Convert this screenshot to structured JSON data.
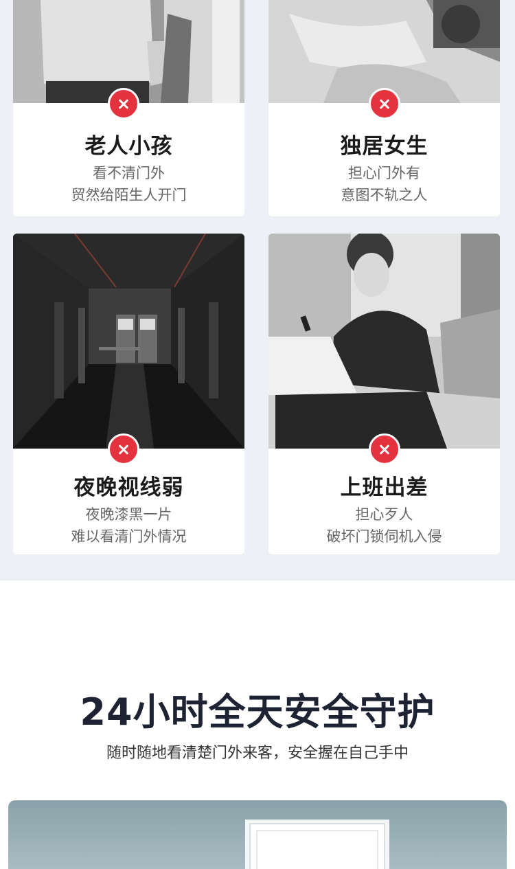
{
  "cards": [
    {
      "title": "老人小孩",
      "line1": "看不清门外",
      "line2": "贸然给陌生人开门",
      "photo_icon": "child-photo",
      "status_icon": "x-mark-icon"
    },
    {
      "title": "独居女生",
      "line1": "担心门外有",
      "line2": "意图不轨之人",
      "photo_icon": "woman-in-bed-photo",
      "status_icon": "x-mark-icon"
    },
    {
      "title": "夜晚视线弱",
      "line1": "夜晚漆黑一片",
      "line2": "难以看清门外情况",
      "photo_icon": "dark-corridor-photo",
      "status_icon": "x-mark-icon"
    },
    {
      "title": "上班出差",
      "line1": "担心歹人",
      "line2": "破坏门锁伺机入侵",
      "photo_icon": "businessman-laptop-photo",
      "status_icon": "x-mark-icon"
    }
  ],
  "section": {
    "headline": "24小时全天安全守护",
    "subline": "随时随地看清楚门外来客，安全握在自己手中"
  },
  "colors": {
    "accent_red": "#e5323f",
    "bg_top": "#edf0f4",
    "headline": "#1e2333"
  }
}
